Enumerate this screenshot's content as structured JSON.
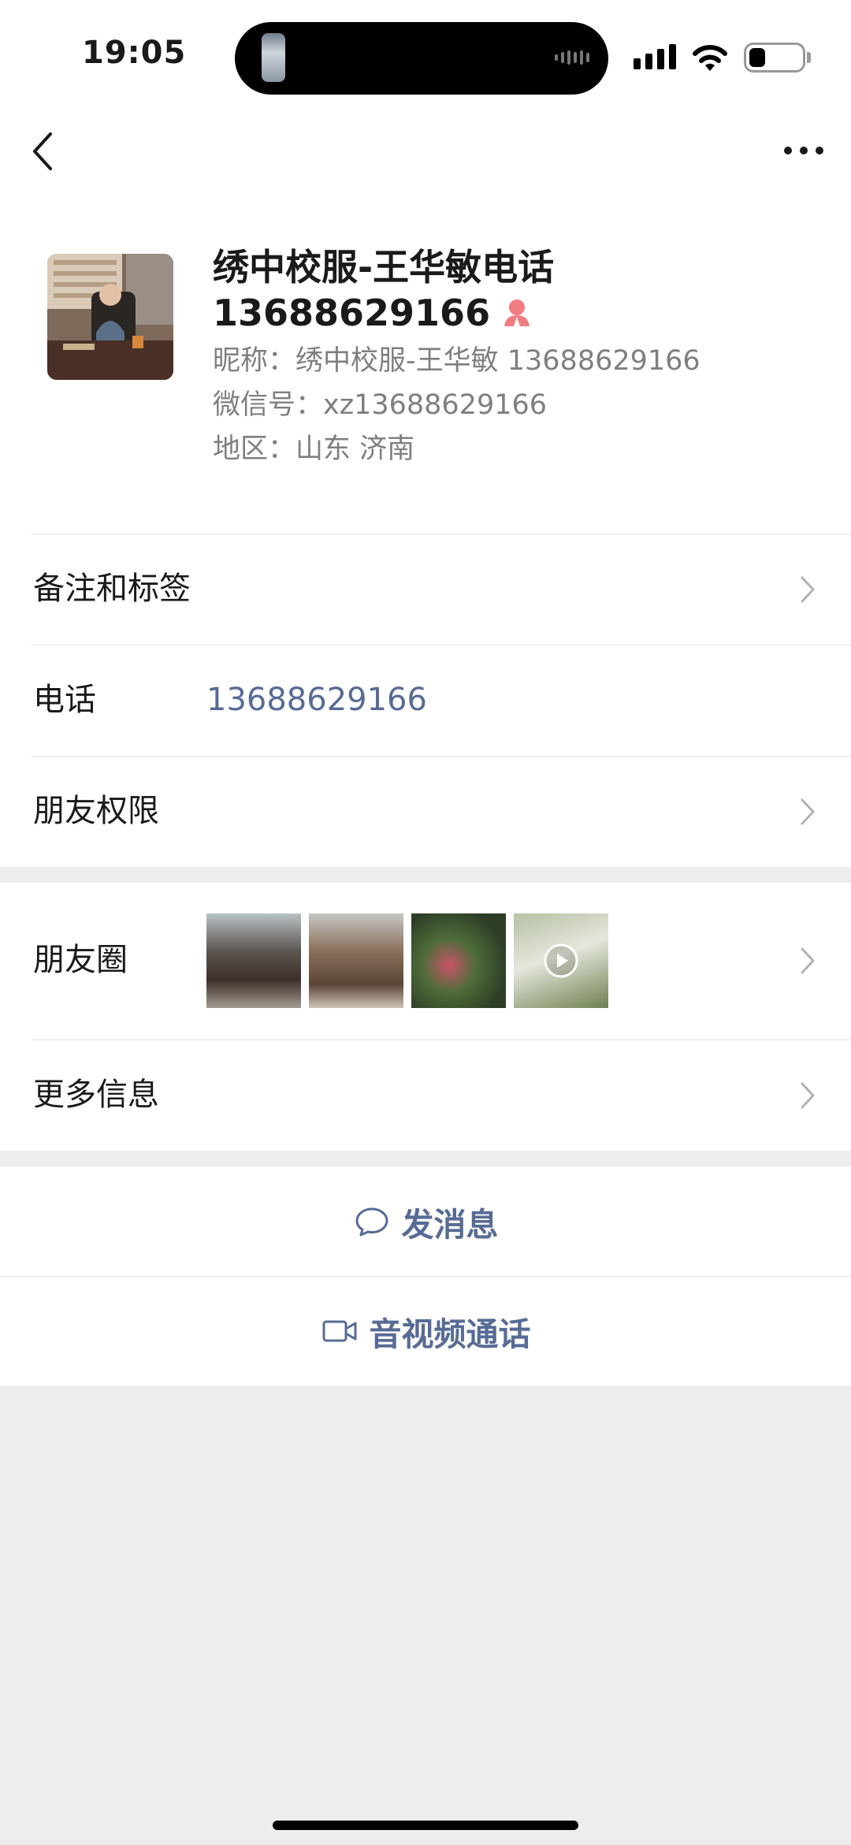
{
  "status_bar": {
    "time": "19:05"
  },
  "profile": {
    "name": "绣中校服-王华敏电话13688629166",
    "nickname": "昵称：绣中校服-王华敏 13688629166",
    "wechat_id": "微信号：xz13688629166",
    "region": "地区：山东 济南",
    "gender_icon": "female-icon",
    "gender_color": "#f07c82"
  },
  "cells": {
    "remark": {
      "label": "备注和标签"
    },
    "phone": {
      "label": "电话",
      "value": "13688629166"
    },
    "permissions": {
      "label": "朋友权限"
    },
    "moments": {
      "label": "朋友圈"
    },
    "more_info": {
      "label": "更多信息"
    }
  },
  "actions": {
    "message": {
      "label": "发消息",
      "icon": "chat-bubble-icon"
    },
    "call": {
      "label": "音视频通话",
      "icon": "video-camera-icon"
    }
  },
  "colors": {
    "link": "#576b95",
    "background": "#ededed"
  }
}
